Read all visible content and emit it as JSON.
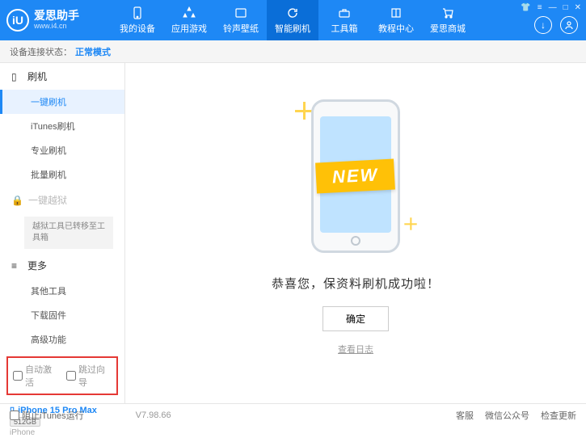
{
  "header": {
    "logo_char": "iU",
    "title": "爱思助手",
    "url": "www.i4.cn",
    "nav": [
      {
        "label": "我的设备"
      },
      {
        "label": "应用游戏"
      },
      {
        "label": "铃声壁纸"
      },
      {
        "label": "智能刷机"
      },
      {
        "label": "工具箱"
      },
      {
        "label": "教程中心"
      },
      {
        "label": "爱思商城"
      }
    ]
  },
  "status": {
    "label": "设备连接状态：",
    "value": "正常模式"
  },
  "sidebar": {
    "group_flash": "刷机",
    "items_flash": [
      "一键刷机",
      "iTunes刷机",
      "专业刷机",
      "批量刷机"
    ],
    "group_jailbreak": "一键越狱",
    "jailbreak_note": "越狱工具已转移至工具箱",
    "group_more": "更多",
    "items_more": [
      "其他工具",
      "下载固件",
      "高级功能"
    ],
    "cb_auto": "自动激活",
    "cb_skip": "跳过向导"
  },
  "device": {
    "name": "iPhone 15 Pro Max",
    "storage": "512GB",
    "type": "iPhone"
  },
  "main": {
    "new_badge": "NEW",
    "success": "恭喜您，保资料刷机成功啦！",
    "ok": "确定",
    "log": "查看日志"
  },
  "footer": {
    "block_itunes": "阻止iTunes运行",
    "version": "V7.98.66",
    "links": [
      "客服",
      "微信公众号",
      "检查更新"
    ]
  }
}
